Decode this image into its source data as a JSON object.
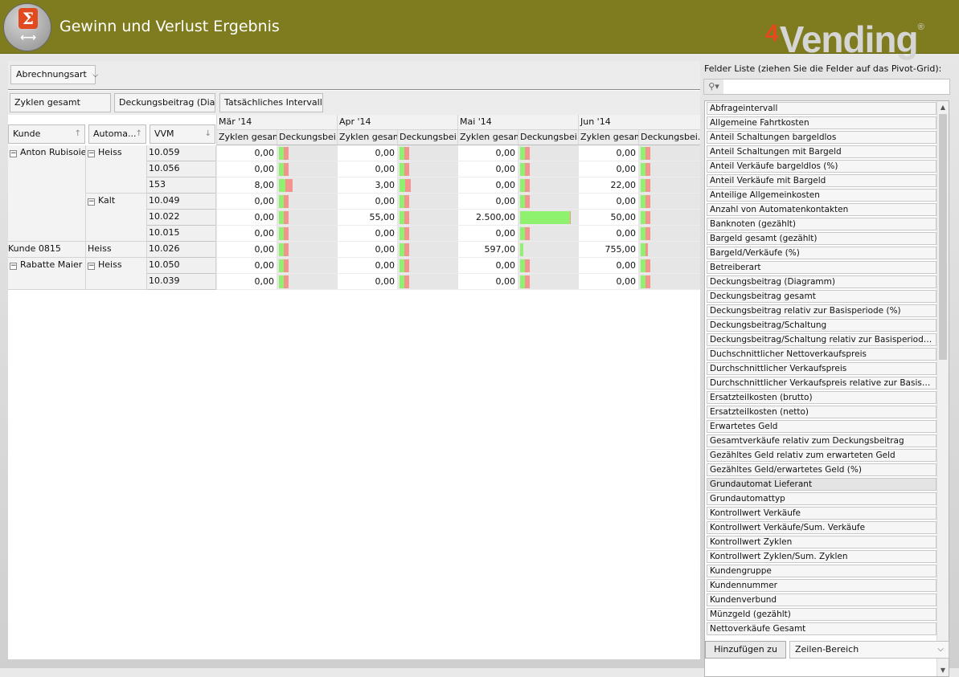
{
  "header": {
    "title": "Gewinn und Verlust Ergebnis",
    "brand_digit": "4",
    "brand_name": "Vending",
    "brand_reg": "®"
  },
  "filter_area": {
    "dropdown_label": "Abrechnungsart"
  },
  "data_fields": [
    "Zyklen gesamt",
    "Deckungsbeitrag (Dia...",
    "Tatsächliches Intervall"
  ],
  "row_fields": [
    "Kunde",
    "Automa...",
    "VVM"
  ],
  "months": [
    "Mär '14",
    "Apr '14",
    "Mai '14",
    "Jun '14"
  ],
  "measures": [
    "Zyklen gesamt",
    "Deckungsbei..."
  ],
  "customers": [
    {
      "name": "Anton Rubisoier",
      "expand": "−"
    },
    {
      "name": "Kunde 0815",
      "expand": ""
    },
    {
      "name": "Rabatte Maier",
      "expand": "−"
    }
  ],
  "automat_groups": [
    {
      "name": "Heiss",
      "expand": "−"
    },
    {
      "name": "Kalt",
      "expand": "−"
    },
    {
      "name": "Heiss",
      "expand": ""
    },
    {
      "name": "Heiss",
      "expand": "−"
    }
  ],
  "rows": [
    {
      "vvm": "10.059",
      "values": [
        "0,00",
        "0,00",
        "0,00",
        "0,00"
      ],
      "bars": [
        [
          0.22,
          0.22
        ],
        [
          0.22,
          0.22
        ],
        [
          0.22,
          0.22
        ],
        [
          0.22,
          0.22
        ]
      ]
    },
    {
      "vvm": "10.056",
      "values": [
        "0,00",
        "0,00",
        "0,00",
        "0,00"
      ],
      "bars": [
        [
          0.22,
          0.22
        ],
        [
          0.22,
          0.22
        ],
        [
          0.22,
          0.22
        ],
        [
          0.22,
          0.22
        ]
      ]
    },
    {
      "vvm": "153",
      "values": [
        "8,00",
        "3,00",
        "0,00",
        "22,00"
      ],
      "bars": [
        [
          0.32,
          0.37
        ],
        [
          0.28,
          0.26
        ],
        [
          0.22,
          0.22
        ],
        [
          0.22,
          0.22
        ]
      ]
    },
    {
      "vvm": "10.049",
      "values": [
        "0,00",
        "0,00",
        "0,00",
        "0,00"
      ],
      "bars": [
        [
          0.22,
          0.22
        ],
        [
          0.22,
          0.22
        ],
        [
          0.22,
          0.22
        ],
        [
          0.22,
          0.22
        ]
      ]
    },
    {
      "vvm": "10.022",
      "values": [
        "0,00",
        "55,00",
        "2.500,00",
        "50,00"
      ],
      "bars": [
        [
          0.22,
          0.22
        ],
        [
          0.22,
          0.22
        ],
        [
          0.97,
          0.03
        ],
        [
          0.22,
          0.22
        ]
      ]
    },
    {
      "vvm": "10.015",
      "values": [
        "0,00",
        "0,00",
        "0,00",
        "0,00"
      ],
      "bars": [
        [
          0.22,
          0.22
        ],
        [
          0.22,
          0.22
        ],
        [
          0.22,
          0.22
        ],
        [
          0.22,
          0.22
        ]
      ]
    },
    {
      "vvm": "10.026",
      "values": [
        "0,00",
        "0,00",
        "597,00",
        "755,00"
      ],
      "bars": [
        [
          0.22,
          0.22
        ],
        [
          0.22,
          0.22
        ],
        [
          0.17,
          0.0
        ],
        [
          0.23,
          0.11
        ]
      ]
    },
    {
      "vvm": "10.050",
      "values": [
        "0,00",
        "0,00",
        "0,00",
        "0,00"
      ],
      "bars": [
        [
          0.22,
          0.22
        ],
        [
          0.22,
          0.22
        ],
        [
          0.22,
          0.22
        ],
        [
          0.22,
          0.22
        ]
      ]
    },
    {
      "vvm": "10.039",
      "values": [
        "0,00",
        "0,00",
        "0,00",
        "0,00"
      ],
      "bars": [
        [
          0.22,
          0.22
        ],
        [
          0.22,
          0.22
        ],
        [
          0.22,
          0.22
        ],
        [
          0.22,
          0.22
        ]
      ]
    }
  ],
  "field_list": {
    "title": "Felder Liste (ziehen Sie die Felder auf das Pivot-Grid):",
    "search_icon": "search-icon",
    "items": [
      "Abfrageintervall",
      "Allgemeine Fahrtkosten",
      "Anteil Schaltungen bargeldlos",
      "Anteil Schaltungen mit Bargeld",
      "Anteil Verkäufe bargeldlos (%)",
      "Anteil Verkäufe mit Bargeld",
      "Anteilige Allgemeinkosten",
      "Anzahl von Automatenkontakten",
      "Banknoten (gezählt)",
      "Bargeld gesamt (gezählt)",
      "Bargeld/Verkäufe (%)",
      "Betreiberart",
      "Deckungsbeitrag (Diagramm)",
      "Deckungsbeitrag gesamt",
      "Deckungsbeitrag relativ zur Basisperiode (%)",
      "Deckungsbeitrag/Schaltung",
      "Deckungsbeitrag/Schaltung relativ zur Basisperiode (%)",
      "Duchschnittlicher Nettoverkaufspreis",
      "Durchschnittlicher Verkaufspreis",
      "Durchschnittlicher Verkaufspreis relative zur Basisperio...",
      "Ersatzteilkosten (brutto)",
      "Ersatzteilkosten (netto)",
      "Erwartetes Geld",
      "Gesamtverkäufe relativ zum Deckungsbeitrag",
      "Gezähltes Geld relativ zum erwarteten Geld",
      "Gezähltes Geld/erwartetes Geld (%)",
      "Grundautomat Lieferant",
      "Grundautomattyp",
      "Kontrollwert Verkäufe",
      "Kontrollwert Verkäufe/Sum. Verkäufe",
      "Kontrollwert Zyklen",
      "Kontrollwert Zyklen/Sum. Zyklen",
      "Kundengruppe",
      "Kundennummer",
      "Kundenverbund",
      "Münzgeld (gezählt)",
      "Nettoverkäufe Gesamt"
    ],
    "highlighted_index": 26,
    "add_button": "Hinzufügen zu",
    "area_select": "Zeilen-Bereich"
  },
  "colors": {
    "header_bg": "#7f7c1f",
    "bar_green": "#8ef26e",
    "bar_red": "#f5938e",
    "brand_accent": "#e34a1c"
  }
}
